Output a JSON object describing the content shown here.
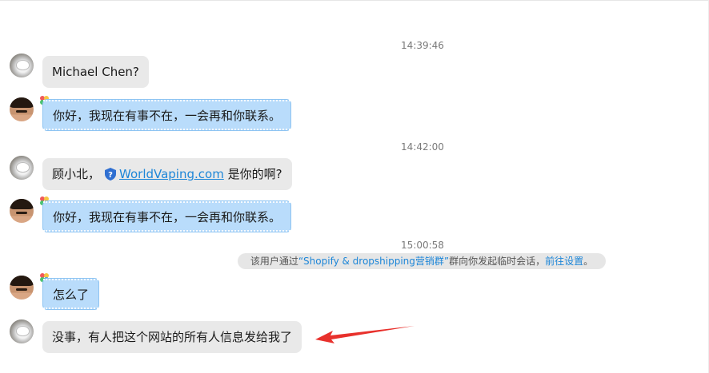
{
  "chat": {
    "messages": [
      {
        "type": "timestamp",
        "text": "14:39:46"
      },
      {
        "type": "message",
        "sender": "contact",
        "text": "Michael Chen?"
      },
      {
        "type": "message",
        "sender": "self",
        "auto_reply": true,
        "text": "你好，我现在有事不在，一会再和你联系。"
      },
      {
        "type": "timestamp",
        "text": "14:42:00"
      },
      {
        "type": "message",
        "sender": "contact",
        "text_before": "顾小北，",
        "link_text": "WorldVaping.com",
        "text_after": " 是你的啊?"
      },
      {
        "type": "message",
        "sender": "self",
        "auto_reply": true,
        "text": "你好，我现在有事不在，一会再和你联系。"
      },
      {
        "type": "timestamp",
        "text": "15:00:58"
      },
      {
        "type": "system_notice",
        "prefix": "该用户通过",
        "group_name": "“Shopify & dropshipping营销群”",
        "middle": "群向你发起临时会话，",
        "link": "前往设置",
        "suffix": "。"
      },
      {
        "type": "message",
        "sender": "self",
        "text": "怎么了"
      },
      {
        "type": "message",
        "sender": "contact",
        "text": "没事，有人把这个网站的所有人信息发给我了"
      }
    ]
  },
  "icons": {
    "shield": "shield-question-icon",
    "badge": "color-balloon-icon",
    "arrow": "red-arrow-annotation"
  },
  "colors": {
    "contact_bubble": "#e9e9e9",
    "self_bubble": "#b9dcfb",
    "link": "#1d86d8",
    "annotation_arrow": "#e8312c"
  }
}
